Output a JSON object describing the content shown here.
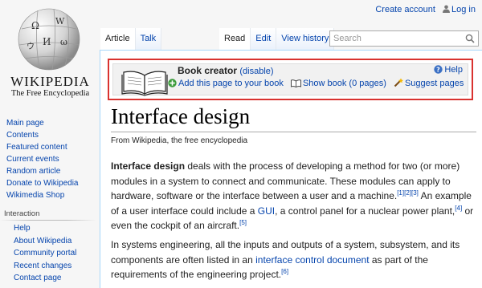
{
  "logo": {
    "wordmark": "WIKIPEDIA",
    "tagline": "The Free Encyclopedia"
  },
  "personal": {
    "create_account": "Create account",
    "login": "Log in"
  },
  "tabs": {
    "left": [
      "Article",
      "Talk"
    ],
    "right": [
      "Read",
      "Edit",
      "View history"
    ]
  },
  "search": {
    "placeholder": "Search"
  },
  "sidebar": {
    "nav": [
      "Main page",
      "Contents",
      "Featured content",
      "Current events",
      "Random article",
      "Donate to Wikipedia",
      "Wikimedia Shop"
    ],
    "interaction_heading": "Interaction",
    "interaction": [
      "Help",
      "About Wikipedia",
      "Community portal",
      "Recent changes",
      "Contact page"
    ]
  },
  "book_creator": {
    "title": "Book creator",
    "disable": "(disable)",
    "help": "Help",
    "add_page": "Add this page to your book",
    "show_book": "Show book (0 pages)",
    "suggest": "Suggest pages"
  },
  "article": {
    "title": "Interface design",
    "from": "From Wikipedia, the free encyclopedia",
    "p1": {
      "bold": "Interface design",
      "t1": " deals with the process of developing a method for two (or more) modules in a system to connect and communicate. These modules can apply to hardware, software or the interface between a user and a machine.",
      "ref1": "[1][2][3]",
      "t2": " An example of a user interface could include a ",
      "link_gui": "GUI",
      "t3": ", a control panel for a nuclear power plant,",
      "ref4": "[4]",
      "t4": " or even the cockpit of an aircraft.",
      "ref5": "[5]"
    },
    "p2": {
      "t1": "In systems engineering, all the inputs and outputs of a system, subsystem, and its components are often listed in an ",
      "link": "interface control document",
      "t2": " as part of the requirements of the engineering project.",
      "ref6": "[6]"
    }
  },
  "colors": {
    "link": "#0645ad",
    "highlight_border": "#d9322f",
    "tab_border": "#a7d7f9"
  }
}
